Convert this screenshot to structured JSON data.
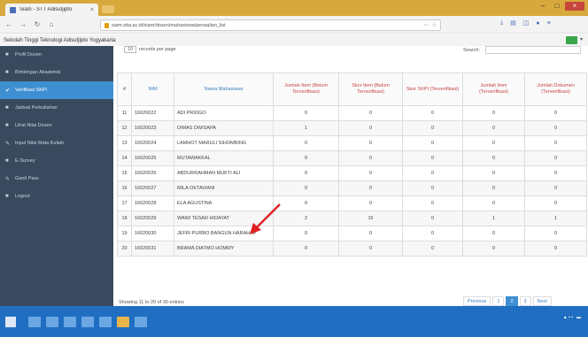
{
  "browser": {
    "tab_title": "Siam - STT Adisutjipto",
    "url": "siam.stta.ac.id/siam/dosen/mahasiswa/perwalian_list",
    "page_title": "Sekolah Tinggi Teknologi Adisutjipto Yogyakarta"
  },
  "sidebar": {
    "items": [
      {
        "label": "Profil Dosen",
        "icon": "user-icon"
      },
      {
        "label": "Bimbingan Akademik",
        "icon": "book-icon"
      },
      {
        "label": "Verifikasi SKPI",
        "icon": "check-icon"
      },
      {
        "label": "Jadwal Perkuliahan",
        "icon": "calendar-icon"
      },
      {
        "label": "Lihat Nilai Dosen",
        "icon": "list-icon"
      },
      {
        "label": "Input Nilai Mata Kuliah",
        "icon": "edit-icon"
      },
      {
        "label": "E-Survey",
        "icon": "survey-icon"
      },
      {
        "label": "Ganti Pass",
        "icon": "key-icon"
      },
      {
        "label": "Logout",
        "icon": "logout-icon"
      }
    ],
    "active_index": 2
  },
  "controls": {
    "length_value": "10",
    "length_label": "records per page",
    "search_label": "Search:"
  },
  "table": {
    "headers": [
      "#",
      "NIM",
      "Nama Mahasiswa",
      "Jumlah Item (Belum Terverifikasi)",
      "Skor Item (Belum Terverifikasi)",
      "Skor SKPI (Terverifikasi)",
      "Jumlah Item (Terverifikasi)",
      "Jumlah Dokumen (Terverifikasi)"
    ],
    "rows": [
      [
        "11",
        "16020022",
        "ADI PRIOGO",
        "0",
        "0",
        "0",
        "0",
        "0"
      ],
      [
        "12",
        "16020023",
        "DIMAS DWISAPA",
        "1",
        "0",
        "0",
        "0",
        "0"
      ],
      [
        "13",
        "16020024",
        "LAMHOT MARULI SIHOMBING",
        "0",
        "0",
        "0",
        "0",
        "0"
      ],
      [
        "14",
        "16020025",
        "MUTAWAKKAL",
        "0",
        "0",
        "0",
        "0",
        "0"
      ],
      [
        "15",
        "16020026",
        "ABDURRAHMAN MUKTI ALI",
        "0",
        "0",
        "0",
        "0",
        "0"
      ],
      [
        "16",
        "16020027",
        "MILA OKTAVIANI",
        "0",
        "0",
        "0",
        "0",
        "0"
      ],
      [
        "17",
        "16020028",
        "ELA AGUSTINA",
        "0",
        "0",
        "0",
        "0",
        "0"
      ],
      [
        "18",
        "16020029",
        "WAWI TESAR HIDAYAT",
        "2",
        "15",
        "0",
        "1",
        "1"
      ],
      [
        "19",
        "16020030",
        "JEFRI PURBO BANGUN HARAHAP",
        "0",
        "0",
        "0",
        "0",
        "0"
      ],
      [
        "20",
        "16020031",
        "BRAMA DIATMO HOMMY",
        "0",
        "0",
        "0",
        "0",
        "0"
      ]
    ]
  },
  "footer": {
    "info": "Showing 11 to 20 of 30 entries",
    "prev": "Previous",
    "pages": [
      "1",
      "2",
      "3"
    ],
    "active_page": "2",
    "next": "Next"
  },
  "colors": {
    "sidebar_bg": "#3a4a5e",
    "sidebar_active": "#3d8fd1",
    "header_red": "#c84545",
    "header_blue": "#3d7fc0",
    "arrow_red": "#e02020",
    "taskbar": "#1f6ec2"
  }
}
